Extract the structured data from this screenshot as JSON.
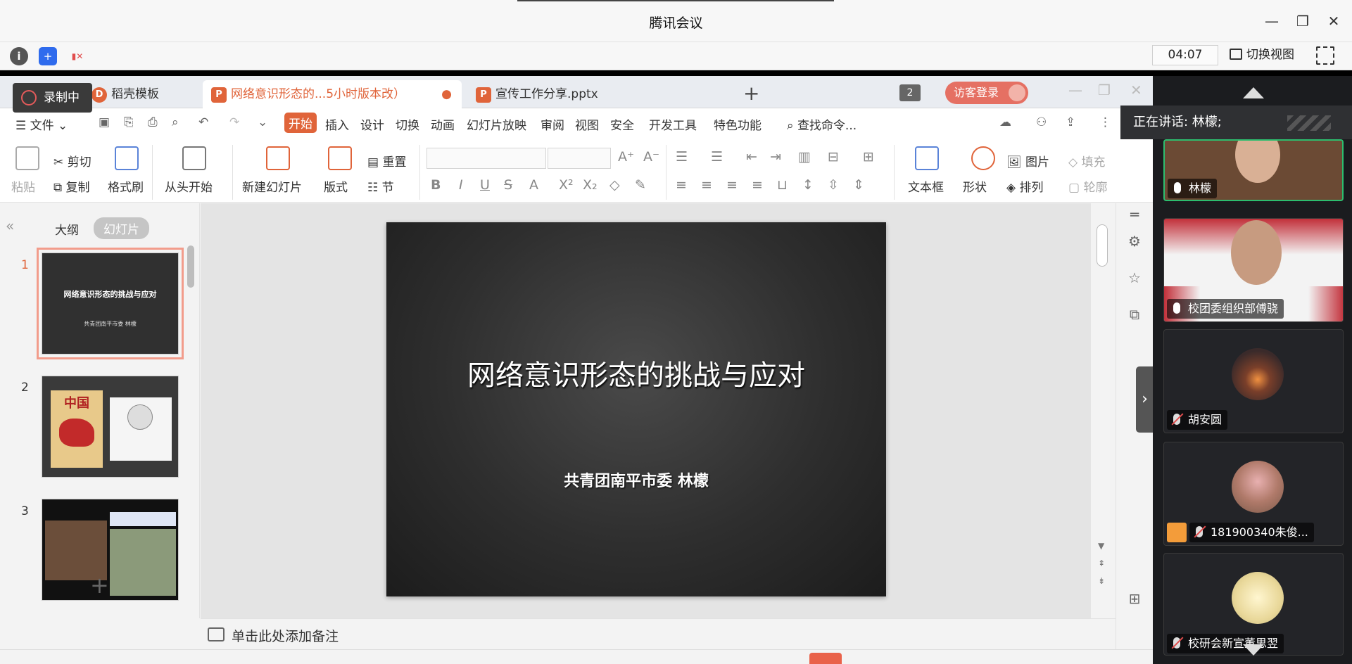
{
  "window": {
    "title": "腾讯会议",
    "controls": [
      "minimize",
      "restore",
      "close"
    ]
  },
  "meeting_toolbar": {
    "timer": "04:07",
    "switch_view": "切换视图"
  },
  "wps": {
    "recording": "录制中",
    "tabs": [
      {
        "label": "稻壳模板",
        "icon": "D"
      },
      {
        "label": "网络意识形态的...5小时版本改）",
        "icon": "P"
      },
      {
        "label": "宣传工作分享.pptx",
        "icon": "P"
      }
    ],
    "window_count": "2",
    "visitor_login": "访客登录",
    "menu": {
      "file": "文件",
      "items": [
        "开始",
        "插入",
        "设计",
        "切换",
        "动画",
        "幻灯片放映",
        "审阅",
        "视图",
        "安全",
        "开发工具",
        "特色功能"
      ],
      "search": "查找命令..."
    },
    "ribbon": {
      "paste": "粘贴",
      "cut": "剪切",
      "copy": "复制",
      "format_painter": "格式刷",
      "from_start": "从头开始",
      "new_slide": "新建幻灯片",
      "layout": "版式",
      "reset": "重置",
      "section": "节",
      "textbox": "文本框",
      "shape": "形状",
      "picture": "图片",
      "arrange": "排列",
      "fill": "填充",
      "outline": "轮廓"
    },
    "panel": {
      "outline_tab": "大纲",
      "slides_tab": "幻灯片",
      "slide_numbers": [
        "1",
        "2",
        "3"
      ]
    },
    "slide": {
      "title": "网络意识形态的挑战与应对",
      "subtitle": "共青团南平市委  林檬"
    },
    "notes_placeholder": "单击此处添加备注",
    "thumb1": {
      "title": "网络意识形态的挑战与应对",
      "sub": "共青团南平市委 林檬"
    },
    "thumb2": {
      "text": "中国"
    }
  },
  "participants": {
    "speaking": "正在讲话: 林檬;",
    "list": [
      {
        "name": "林檬",
        "mic": "on",
        "active": true
      },
      {
        "name": "校团委组织部傅骁",
        "mic": "on",
        "active": false
      },
      {
        "name": "胡安圆",
        "mic": "off",
        "active": false
      },
      {
        "name": "181900340朱俊...",
        "mic": "off",
        "active": false
      },
      {
        "name": "校研会新宣董思翌",
        "mic": "off",
        "active": false
      }
    ]
  }
}
